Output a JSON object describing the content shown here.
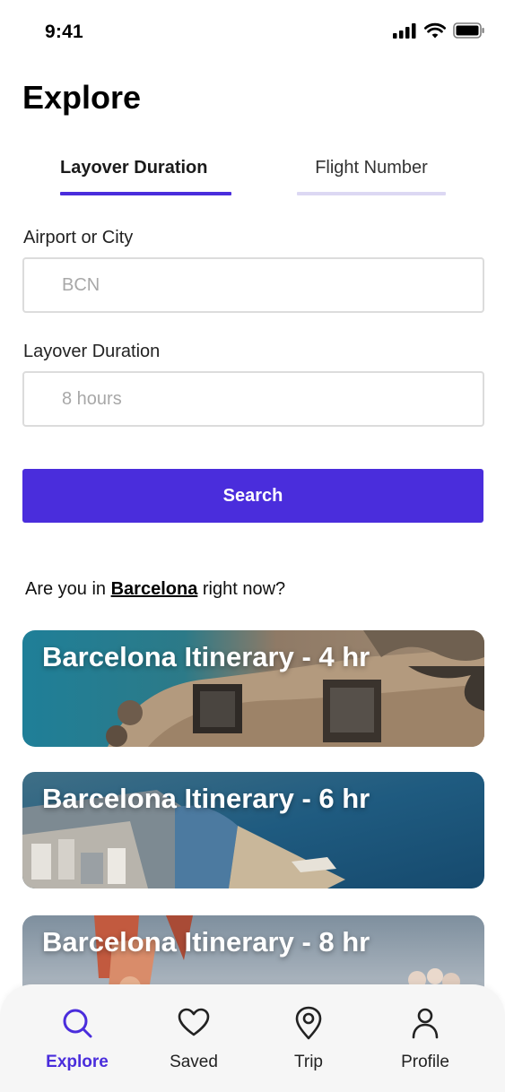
{
  "status_bar": {
    "time": "9:41"
  },
  "page": {
    "title": "Explore"
  },
  "tabs": [
    {
      "label": "Layover Duration",
      "active": true
    },
    {
      "label": "Flight Number",
      "active": false
    }
  ],
  "form": {
    "airport": {
      "label": "Airport or City",
      "placeholder": "BCN",
      "value": ""
    },
    "duration": {
      "label": "Layover Duration",
      "placeholder": "8 hours",
      "value": ""
    },
    "search_label": "Search"
  },
  "location_prompt": {
    "prefix": "Are you in ",
    "city": "Barcelona",
    "suffix": " right now?"
  },
  "itineraries": [
    {
      "title": "Barcelona Itinerary - 4 hr"
    },
    {
      "title": "Barcelona Itinerary - 6 hr"
    },
    {
      "title": "Barcelona Itinerary - 8 hr"
    }
  ],
  "bottom_nav": [
    {
      "label": "Explore",
      "icon": "search-icon",
      "active": true
    },
    {
      "label": "Saved",
      "icon": "heart-icon",
      "active": false
    },
    {
      "label": "Trip",
      "icon": "map-pin-icon",
      "active": false
    },
    {
      "label": "Profile",
      "icon": "user-icon",
      "active": false
    }
  ],
  "colors": {
    "accent": "#4a2ddc",
    "accent_light": "#dcd8f3"
  }
}
